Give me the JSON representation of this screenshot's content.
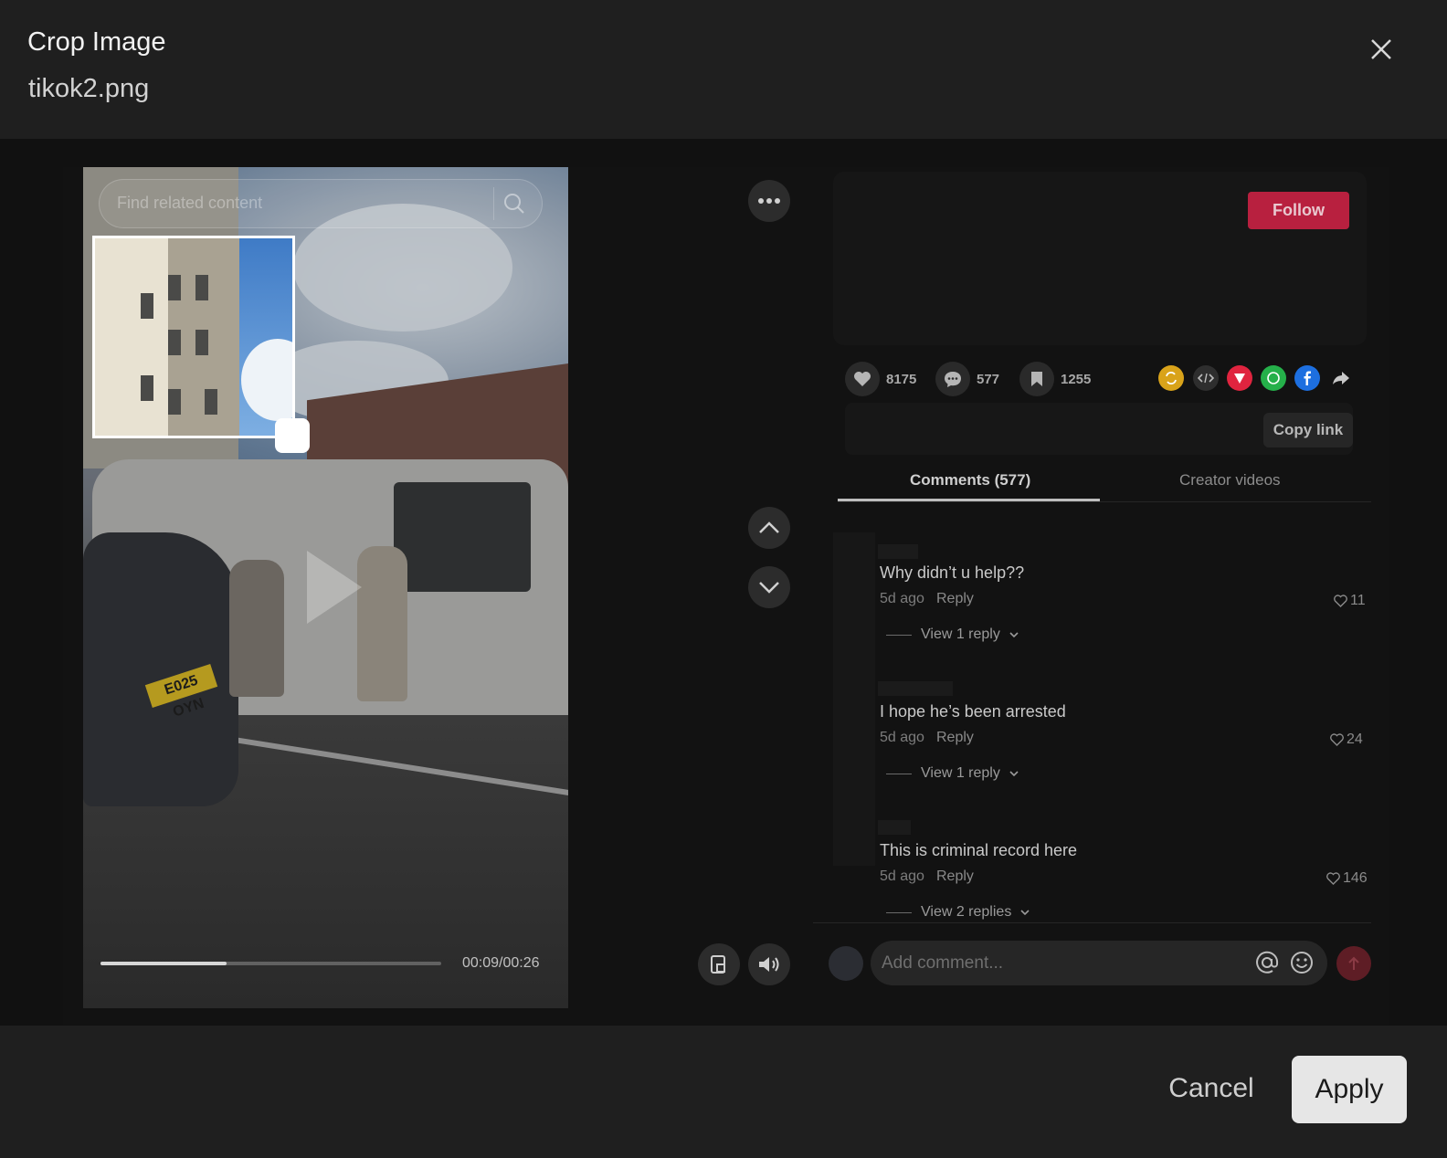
{
  "dialog": {
    "title": "Crop Image",
    "filename": "tikok2.png",
    "cancel_label": "Cancel",
    "apply_label": "Apply"
  },
  "video": {
    "search_placeholder": "Find related content",
    "plate_text": "E025 OYN",
    "time": "00:09/00:26",
    "progress": 0.37
  },
  "profile": {
    "follow_label": "Follow"
  },
  "stats": {
    "likes": "8175",
    "comments": "577",
    "saves": "1255"
  },
  "share": {
    "copy_link_label": "Copy link",
    "icons": [
      "repost-icon",
      "embed-icon",
      "send-icon",
      "whatsapp-icon",
      "facebook-icon",
      "share-arrow-icon"
    ],
    "colors": {
      "repost": "#d9a31a",
      "embed": "#3a3a3a",
      "send": "#e0243f",
      "whatsapp": "#25b04a",
      "facebook": "#1d6fe0"
    }
  },
  "tabs": {
    "comments": "Comments (577)",
    "creator_videos": "Creator videos"
  },
  "comments": [
    {
      "text": "Why didn’t u help??",
      "time": "5d ago",
      "reply": "Reply",
      "likes": "11",
      "view_replies": "View 1 reply"
    },
    {
      "text": "I hope he’s been arrested",
      "time": "5d ago",
      "reply": "Reply",
      "likes": "24",
      "view_replies": "View 1 reply"
    },
    {
      "text": "This is criminal record here",
      "time": "5d ago",
      "reply": "Reply",
      "likes": "146",
      "view_replies": "View 2 replies"
    }
  ],
  "comment_box": {
    "placeholder": "Add comment..."
  },
  "colors": {
    "follow": "#b8203f",
    "apply_bg": "#e6e6e6"
  }
}
